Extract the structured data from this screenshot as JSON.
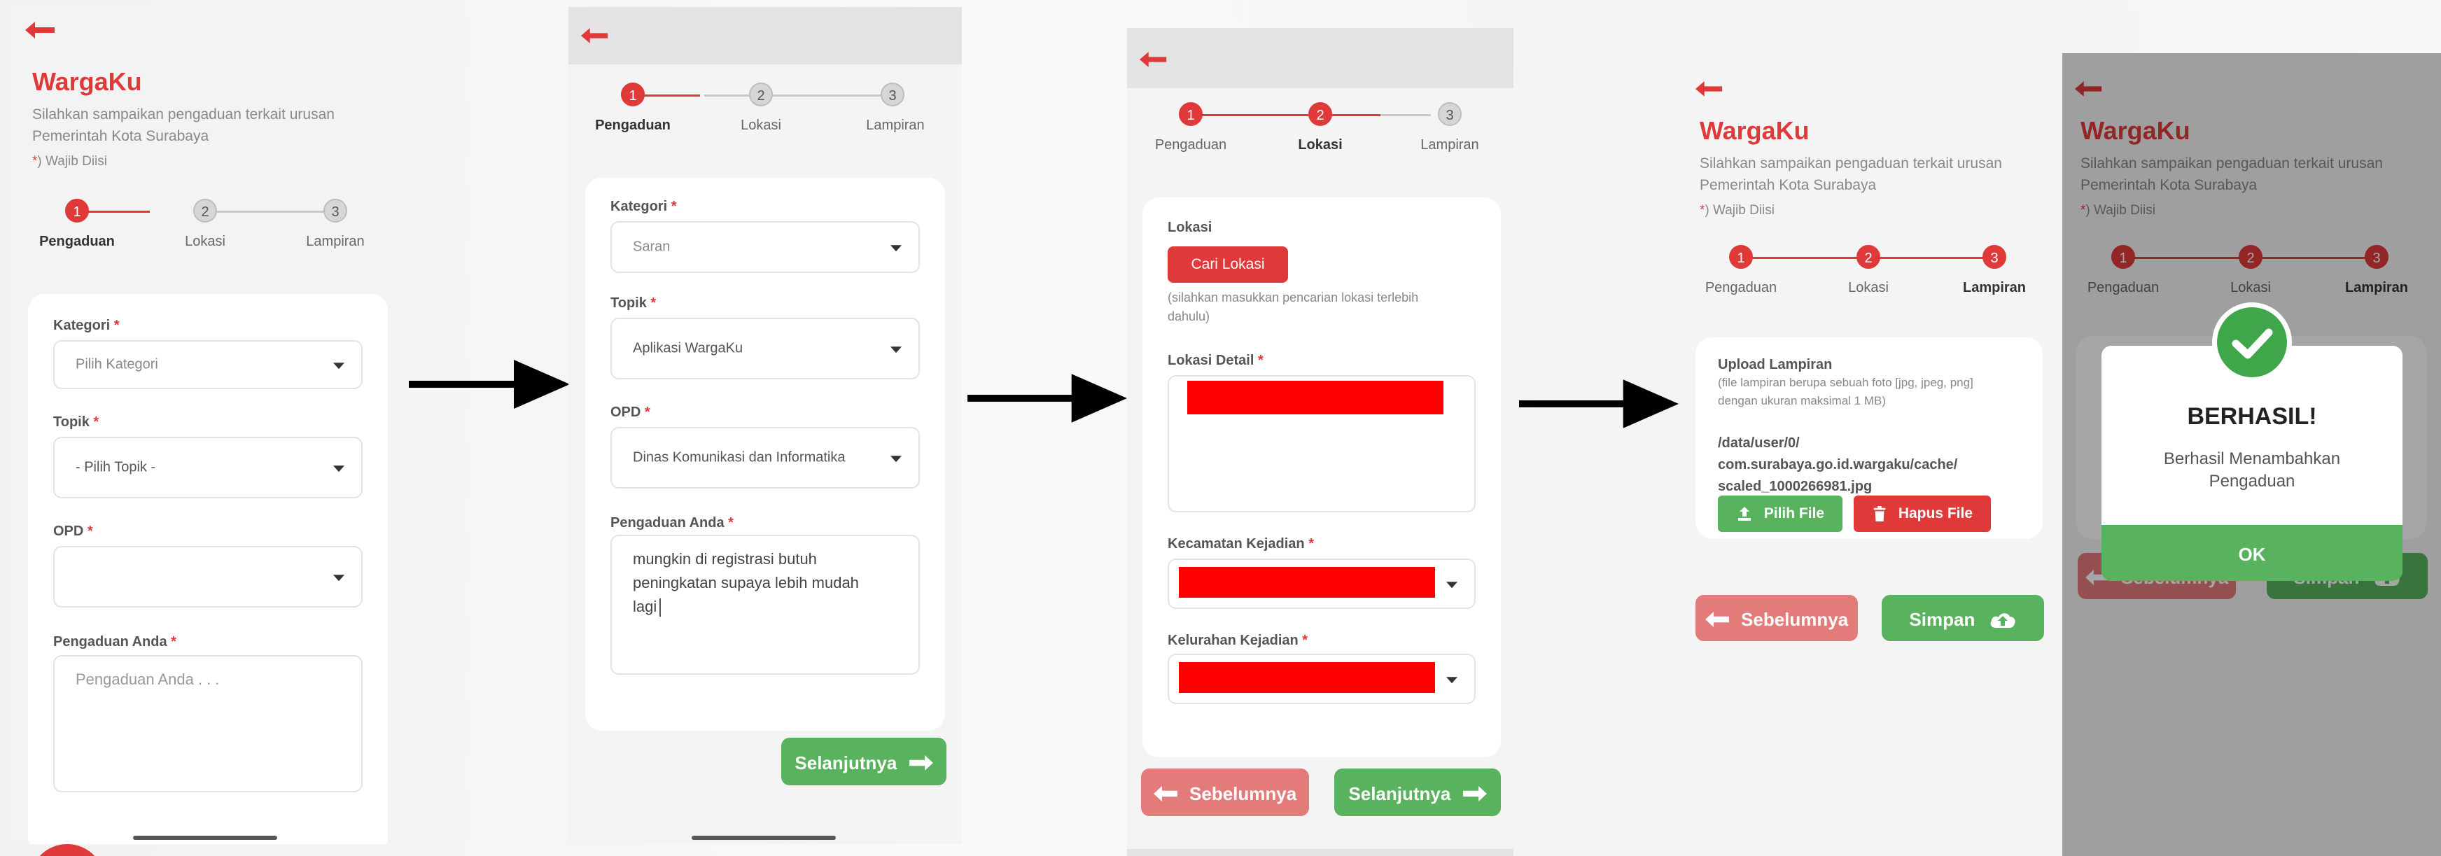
{
  "app": {
    "title": "WargaKu",
    "subtitle_line1": "Silahkan sampaikan pengaduan terkait urusan",
    "subtitle_line2": "Pemerintah Kota Surabaya",
    "required_note": ") Wajib Diisi",
    "required_star": "*"
  },
  "stepper": {
    "steps": [
      {
        "num": "1",
        "label": "Pengaduan"
      },
      {
        "num": "2",
        "label": "Lokasi"
      },
      {
        "num": "3",
        "label": "Lampiran"
      }
    ]
  },
  "screen1": {
    "kategori_label": "Kategori",
    "kategori_placeholder": "Pilih Kategori",
    "topik_label": "Topik",
    "topik_placeholder": "- Pilih Topik -",
    "opd_label": "OPD",
    "pengaduan_label": "Pengaduan Anda",
    "pengaduan_placeholder": "Pengaduan Anda . . ."
  },
  "screen2": {
    "kategori_label": "Kategori",
    "kategori_value": "Saran",
    "topik_label": "Topik",
    "topik_value": "Aplikasi WargaKu",
    "opd_label": "OPD",
    "opd_value": "Dinas Komunikasi dan Informatika",
    "pengaduan_label": "Pengaduan Anda",
    "pengaduan_line1": "mungkin di registrasi butuh",
    "pengaduan_line2": "peningkatan supaya lebih mudah",
    "pengaduan_line3": "lagi",
    "next_button": "Selanjutnya"
  },
  "screen3": {
    "lokasi_label": "Lokasi",
    "cari_button": "Cari Lokasi",
    "hint_line1": "(silahkan masukkan pencarian lokasi terlebih",
    "hint_line2": "dahulu)",
    "detail_label": "Lokasi Detail",
    "kecamatan_label": "Kecamatan Kejadian",
    "kelurahan_label": "Kelurahan Kejadian",
    "prev_button": "Sebelumnya",
    "next_button": "Selanjutnya"
  },
  "screen4": {
    "upload_title": "Upload Lampiran",
    "upload_hint_line1": "(file lampiran berupa sebuah foto [jpg, jpeg, png]",
    "upload_hint_line2": "dengan ukuran maksimal 1 MB)",
    "file_line1": "/data/user/0/",
    "file_line2": "com.surabaya.go.id.wargaku/cache/",
    "file_line3": "scaled_1000266981.jpg",
    "pilih_button": "Pilih File",
    "hapus_button": "Hapus File",
    "prev_button": "Sebelumnya",
    "save_button": "Simpan"
  },
  "screen5": {
    "dialog_title": "BERHASIL!",
    "dialog_msg_line1": "Berhasil Menambahkan",
    "dialog_msg_line2": "Pengaduan",
    "ok_button": "OK",
    "prev_button": "Sebelumnya",
    "save_button": "Simpan"
  },
  "colors": {
    "accent": "#e0393a",
    "success": "#58b25e",
    "muted": "#888888"
  }
}
